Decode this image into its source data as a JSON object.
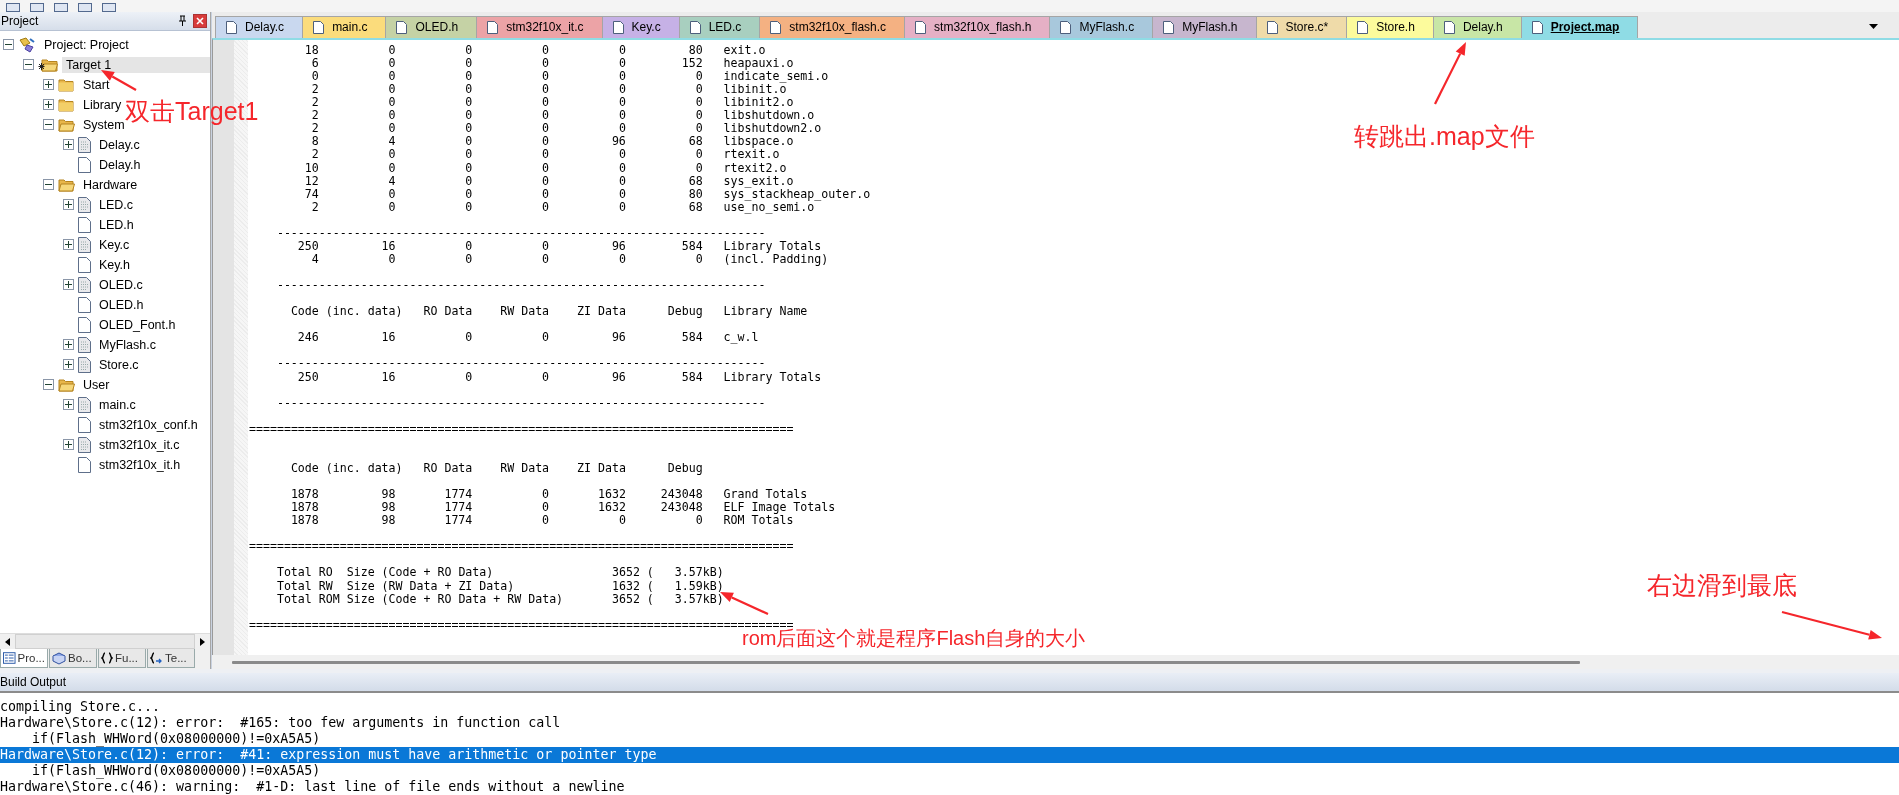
{
  "project_panel": {
    "title": "Project",
    "tree": [
      {
        "label": "Project: Project",
        "kind": "project",
        "expanded": true,
        "selected": false,
        "children": [
          {
            "label": "Target 1",
            "kind": "target",
            "expanded": true,
            "selected": true,
            "children": [
              {
                "label": "Start",
                "kind": "folder",
                "expanded": false,
                "selected": false
              },
              {
                "label": "Library",
                "kind": "folder",
                "expanded": false,
                "selected": false
              },
              {
                "label": "System",
                "kind": "folder",
                "expanded": true,
                "selected": false,
                "children": [
                  {
                    "label": "Delay.c",
                    "kind": "source",
                    "expanded": false,
                    "selected": false
                  },
                  {
                    "label": "Delay.h",
                    "kind": "header",
                    "selected": false
                  }
                ]
              },
              {
                "label": "Hardware",
                "kind": "folder",
                "expanded": true,
                "selected": false,
                "children": [
                  {
                    "label": "LED.c",
                    "kind": "source",
                    "expanded": false,
                    "selected": false
                  },
                  {
                    "label": "LED.h",
                    "kind": "header",
                    "selected": false
                  },
                  {
                    "label": "Key.c",
                    "kind": "source",
                    "expanded": false,
                    "selected": false
                  },
                  {
                    "label": "Key.h",
                    "kind": "header",
                    "selected": false
                  },
                  {
                    "label": "OLED.c",
                    "kind": "source",
                    "expanded": false,
                    "selected": false
                  },
                  {
                    "label": "OLED.h",
                    "kind": "header",
                    "selected": false
                  },
                  {
                    "label": "OLED_Font.h",
                    "kind": "header",
                    "selected": false
                  },
                  {
                    "label": "MyFlash.c",
                    "kind": "source",
                    "expanded": false,
                    "selected": false
                  },
                  {
                    "label": "Store.c",
                    "kind": "source",
                    "expanded": false,
                    "selected": false
                  }
                ]
              },
              {
                "label": "User",
                "kind": "folder",
                "expanded": true,
                "selected": false,
                "children": [
                  {
                    "label": "main.c",
                    "kind": "source",
                    "expanded": false,
                    "selected": false
                  },
                  {
                    "label": "stm32f10x_conf.h",
                    "kind": "header",
                    "selected": false
                  },
                  {
                    "label": "stm32f10x_it.c",
                    "kind": "source",
                    "expanded": false,
                    "selected": false
                  },
                  {
                    "label": "stm32f10x_it.h",
                    "kind": "header",
                    "selected": false
                  }
                ]
              }
            ]
          }
        ]
      }
    ],
    "bottom_tabs": [
      {
        "label": "Pro...",
        "kind": "project",
        "selected": true
      },
      {
        "label": "Bo...",
        "kind": "books",
        "selected": false
      },
      {
        "label": "Fu...",
        "kind": "functions",
        "selected": false
      },
      {
        "label": "Te...",
        "kind": "templates",
        "selected": false
      }
    ]
  },
  "editor_tabs": [
    {
      "label": "Delay.c",
      "color": "#c9d8ef",
      "selected": false
    },
    {
      "label": "main.c",
      "color": "#fbdc7c",
      "selected": false
    },
    {
      "label": "OLED.h",
      "color": "#c5d2a5",
      "selected": false
    },
    {
      "label": "stm32f10x_it.c",
      "color": "#eca3a6",
      "selected": false
    },
    {
      "label": "Key.c",
      "color": "#c6b1e6",
      "selected": false
    },
    {
      "label": "LED.c",
      "color": "#a8cfbf",
      "selected": false
    },
    {
      "label": "stm32f10x_flash.c",
      "color": "#f4b182",
      "selected": false
    },
    {
      "label": "stm32f10x_flash.h",
      "color": "#e5b0c5",
      "selected": false
    },
    {
      "label": "MyFlash.c",
      "color": "#a8c8dc",
      "selected": false
    },
    {
      "label": "MyFlash.h",
      "color": "#c7b6ce",
      "selected": false
    },
    {
      "label": "Store.c*",
      "color": "#efdba9",
      "selected": false
    },
    {
      "label": "Store.h",
      "color": "#fcfb9c",
      "selected": false
    },
    {
      "label": "Delay.h",
      "color": "#c8e6a6",
      "selected": false
    },
    {
      "label": "Project.map",
      "color": "#8fdce5",
      "selected": true
    }
  ],
  "map_lines": [
    {
      "kind": "row",
      "values": [
        "18",
        "0",
        "0",
        "0",
        "0",
        "80"
      ],
      "name": "exit.o"
    },
    {
      "kind": "row",
      "values": [
        "6",
        "0",
        "0",
        "0",
        "0",
        "152"
      ],
      "name": "heapauxi.o"
    },
    {
      "kind": "row",
      "values": [
        "0",
        "0",
        "0",
        "0",
        "0",
        "0"
      ],
      "name": "indicate_semi.o"
    },
    {
      "kind": "row",
      "values": [
        "2",
        "0",
        "0",
        "0",
        "0",
        "0"
      ],
      "name": "libinit.o"
    },
    {
      "kind": "row",
      "values": [
        "2",
        "0",
        "0",
        "0",
        "0",
        "0"
      ],
      "name": "libinit2.o"
    },
    {
      "kind": "row",
      "values": [
        "2",
        "0",
        "0",
        "0",
        "0",
        "0"
      ],
      "name": "libshutdown.o"
    },
    {
      "kind": "row",
      "values": [
        "2",
        "0",
        "0",
        "0",
        "0",
        "0"
      ],
      "name": "libshutdown2.o"
    },
    {
      "kind": "row",
      "values": [
        "8",
        "4",
        "0",
        "0",
        "96",
        "68"
      ],
      "name": "libspace.o"
    },
    {
      "kind": "row",
      "values": [
        "2",
        "0",
        "0",
        "0",
        "0",
        "0"
      ],
      "name": "rtexit.o"
    },
    {
      "kind": "row",
      "values": [
        "10",
        "0",
        "0",
        "0",
        "0",
        "0"
      ],
      "name": "rtexit2.o"
    },
    {
      "kind": "row",
      "values": [
        "12",
        "4",
        "0",
        "0",
        "0",
        "68"
      ],
      "name": "sys_exit.o"
    },
    {
      "kind": "row",
      "values": [
        "74",
        "0",
        "0",
        "0",
        "0",
        "80"
      ],
      "name": "sys_stackheap_outer.o"
    },
    {
      "kind": "row",
      "values": [
        "2",
        "0",
        "0",
        "0",
        "0",
        "68"
      ],
      "name": "use_no_semi.o"
    },
    {
      "kind": "blank"
    },
    {
      "kind": "dash_rule",
      "text": "----------------------------------------------------------------------"
    },
    {
      "kind": "row",
      "values": [
        "250",
        "16",
        "0",
        "0",
        "96",
        "584"
      ],
      "name": "Library Totals"
    },
    {
      "kind": "row",
      "values": [
        "4",
        "0",
        "0",
        "0",
        "0",
        "0"
      ],
      "name": "(incl. Padding)"
    },
    {
      "kind": "blank"
    },
    {
      "kind": "dash_rule",
      "text": "----------------------------------------------------------------------"
    },
    {
      "kind": "blank"
    },
    {
      "kind": "header",
      "columns": [
        "Code",
        "(inc. data)",
        "RO Data",
        "RW Data",
        "ZI Data",
        "Debug",
        "Library Name"
      ]
    },
    {
      "kind": "blank"
    },
    {
      "kind": "row",
      "values": [
        "246",
        "16",
        "0",
        "0",
        "96",
        "584"
      ],
      "name": "c_w.l"
    },
    {
      "kind": "blank"
    },
    {
      "kind": "dash_rule",
      "text": "----------------------------------------------------------------------"
    },
    {
      "kind": "row",
      "values": [
        "250",
        "16",
        "0",
        "0",
        "96",
        "584"
      ],
      "name": "Library Totals"
    },
    {
      "kind": "blank"
    },
    {
      "kind": "dash_rule",
      "text": "----------------------------------------------------------------------"
    },
    {
      "kind": "blank"
    },
    {
      "kind": "double_rule",
      "text": "=============================================================================="
    },
    {
      "kind": "blank"
    },
    {
      "kind": "blank"
    },
    {
      "kind": "header",
      "columns": [
        "Code",
        "(inc. data)",
        "RO Data",
        "RW Data",
        "ZI Data",
        "Debug"
      ]
    },
    {
      "kind": "blank"
    },
    {
      "kind": "row",
      "values": [
        "1878",
        "98",
        "1774",
        "0",
        "1632",
        "243048"
      ],
      "name": "Grand Totals"
    },
    {
      "kind": "row",
      "values": [
        "1878",
        "98",
        "1774",
        "0",
        "1632",
        "243048"
      ],
      "name": "ELF Image Totals"
    },
    {
      "kind": "row",
      "values": [
        "1878",
        "98",
        "1774",
        "0",
        "0",
        "0"
      ],
      "name": "ROM Totals"
    },
    {
      "kind": "blank"
    },
    {
      "kind": "double_rule",
      "text": "=============================================================================="
    },
    {
      "kind": "blank"
    },
    {
      "kind": "size",
      "label": "Total RO  Size (Code + RO Data)",
      "value": "3652 (   3.57kB)"
    },
    {
      "kind": "size",
      "label": "Total RW  Size (RW Data + ZI Data)",
      "value": "1632 (   1.59kB)"
    },
    {
      "kind": "size",
      "label": "Total ROM Size (Code + RO Data + RW Data)",
      "value": "3652 (   3.57kB)"
    },
    {
      "kind": "blank"
    },
    {
      "kind": "double_rule",
      "text": "=============================================================================="
    }
  ],
  "build_output": {
    "title": "Build Output",
    "lines": [
      {
        "text": "compiling Store.c...",
        "selected": false
      },
      {
        "text": "Hardware\\Store.c(12): error:  #165: too few arguments in function call",
        "selected": false
      },
      {
        "text": "    if(Flash_WHWord(0x08000000)!=0xA5A5)",
        "selected": false
      },
      {
        "text": "Hardware\\Store.c(12): error:  #41: expression must have arithmetic or pointer type",
        "selected": true
      },
      {
        "text": "    if(Flash_WHWord(0x08000000)!=0xA5A5)",
        "selected": false
      },
      {
        "text": "Hardware\\Store.c(46): warning:  #1-D: last line of file ends without a newline",
        "selected": false
      }
    ]
  },
  "annotations": [
    {
      "text": "双击Target1"
    },
    {
      "text": "转跳出.map文件"
    },
    {
      "text": "rom后面这个就是程序Flash自身的大小"
    },
    {
      "text": "右边滑到最底"
    }
  ]
}
